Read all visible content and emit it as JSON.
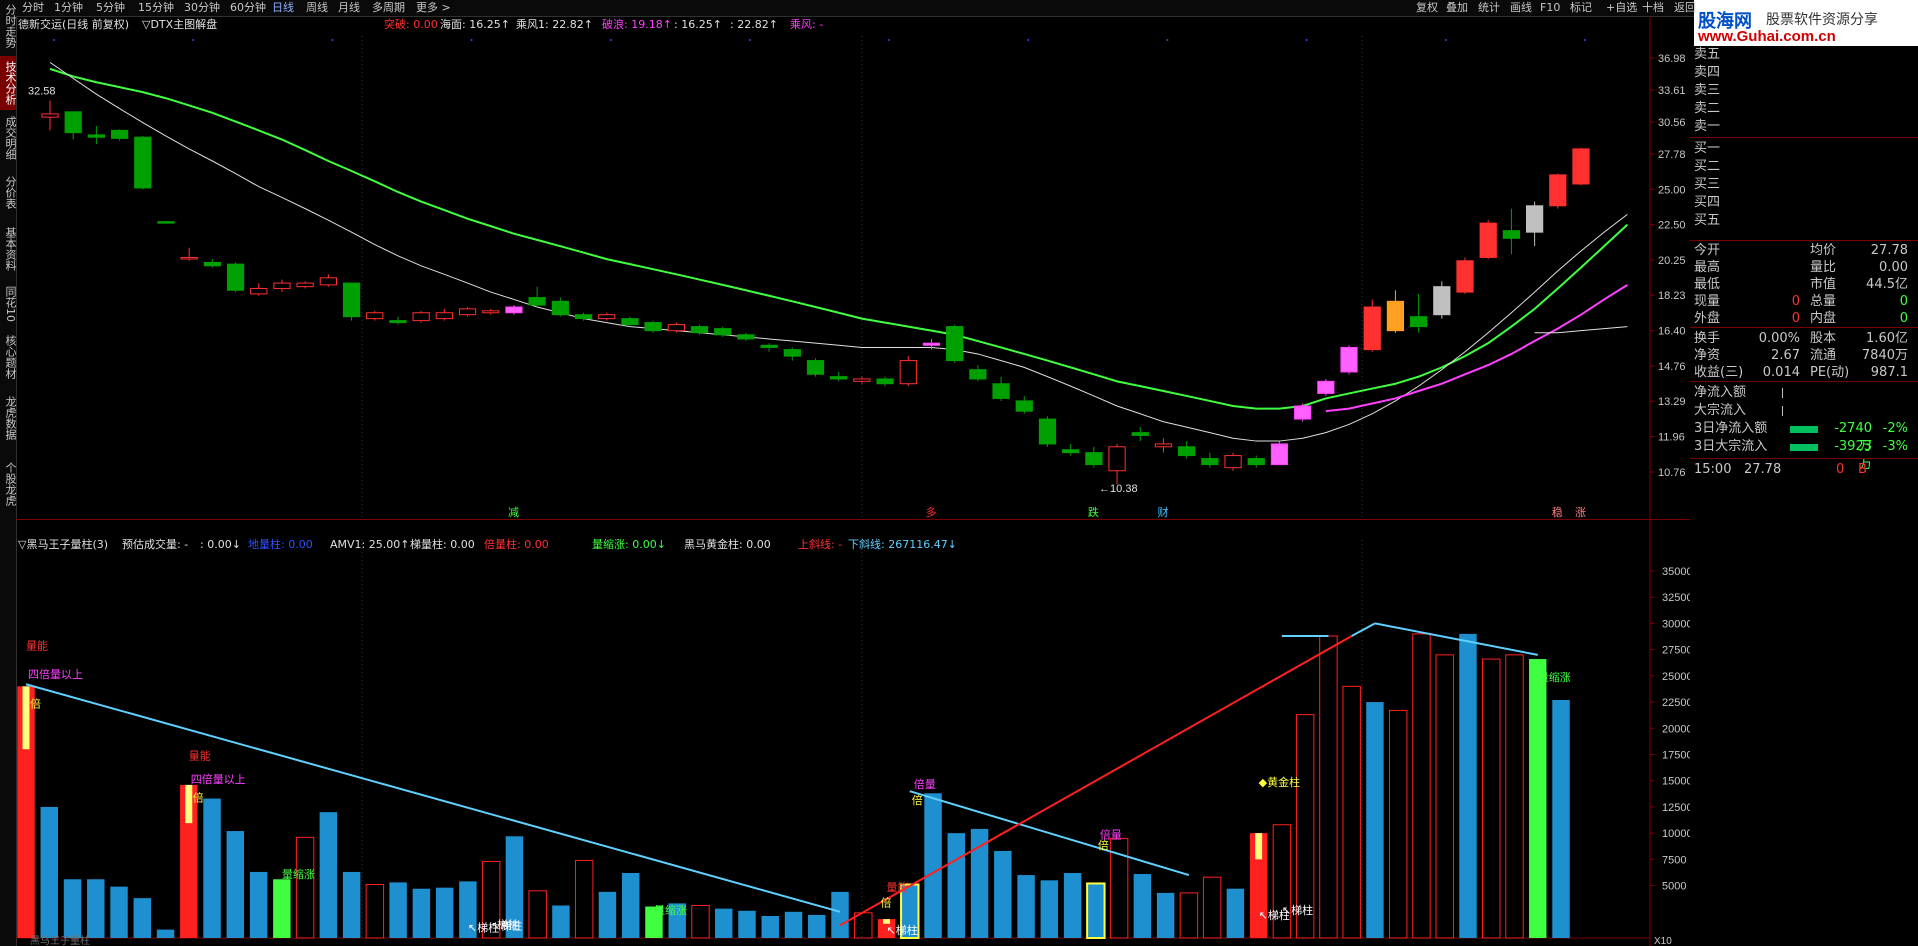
{
  "leftbar": {
    "items": [
      {
        "label": "分时走势",
        "active": false
      },
      {
        "label": "技术分析",
        "active": true
      },
      {
        "label": "成交明细",
        "active": false
      },
      {
        "label": "分价表",
        "active": false
      },
      {
        "label": "基本资料",
        "active": false
      },
      {
        "label": "同花10",
        "active": false
      },
      {
        "label": "核心题材",
        "active": false
      },
      {
        "label": "龙虎数据",
        "active": false
      },
      {
        "label": "个股龙虎",
        "active": false
      }
    ]
  },
  "topbar": {
    "periods": [
      {
        "label": "分时"
      },
      {
        "label": "1分钟"
      },
      {
        "label": "5分钟"
      },
      {
        "label": "15分钟"
      },
      {
        "label": "30分钟"
      },
      {
        "label": "60分钟"
      },
      {
        "label": "日线",
        "selected": true
      },
      {
        "label": "周线"
      },
      {
        "label": "月线"
      },
      {
        "label": "多周期"
      },
      {
        "label": "更多 >"
      }
    ],
    "tools": [
      {
        "label": "复权"
      },
      {
        "label": "叠加"
      },
      {
        "label": "统计"
      },
      {
        "label": "画线"
      },
      {
        "label": "F10"
      },
      {
        "label": "标记"
      },
      {
        "label": "+自选"
      },
      {
        "label": "十档"
      },
      {
        "label": "返回"
      }
    ]
  },
  "logo": {
    "brand": "股海网",
    "slogan": "股票软件资源分享",
    "url": "www.Guhai.com.cn"
  },
  "main_header": {
    "stock": "德新交运(日线 前复权)",
    "formula": "▽DTX主图解盘",
    "items": [
      {
        "text": "突破: 0.00",
        "color": "#ff3030"
      },
      {
        "text": "海面: 16.25↑",
        "color": "#e0e0e0"
      },
      {
        "text": "乘风1: 22.82↑",
        "color": "#e0e0e0"
      },
      {
        "text": "破浪: 19.18↑",
        "color": "#ff40ff"
      },
      {
        "text": ": 16.25↑",
        "color": "#e0e0e0"
      },
      {
        "text": ": 22.82↑",
        "color": "#e0e0e0"
      },
      {
        "text": "乘风: -",
        "color": "#ff40ff"
      }
    ]
  },
  "vol_header": {
    "formula": "▽黑马王子量柱(3)",
    "items": [
      {
        "text": "预估成交量: -",
        "color": "#e0e0e0"
      },
      {
        "text": ": 0.00↓",
        "color": "#e0e0e0"
      },
      {
        "text": "地量柱: 0.00",
        "color": "#3050ff"
      },
      {
        "text": "AMV1: 25.00↑",
        "color": "#e0e0e0"
      },
      {
        "text": "梯量柱: 0.00",
        "color": "#e0e0e0"
      },
      {
        "text": "倍量柱: 0.00",
        "color": "#ff3030"
      },
      {
        "text": "量缩涨: 0.00↓",
        "color": "#40ff40"
      },
      {
        "text": "黑马黄金柱: 0.00",
        "color": "#e0e0e0"
      },
      {
        "text": "上斜线: -",
        "color": "#ff3030"
      },
      {
        "text": "下斜线: 267116.47↓",
        "color": "#60d0ff"
      }
    ]
  },
  "price_axis": [
    "36.98",
    "33.61",
    "30.56",
    "27.78",
    "25.00",
    "22.50",
    "20.25",
    "18.23",
    "16.40",
    "14.76",
    "13.29",
    "11.96",
    "10.76"
  ],
  "vol_axis": [
    "35000",
    "32500",
    "30000",
    "27500",
    "25000",
    "22500",
    "20000",
    "17500",
    "15000",
    "12500",
    "10000",
    "7500",
    "5000"
  ],
  "vol_axis_unit": "X10",
  "price_labels": {
    "high": "32.58",
    "low": "←10.38"
  },
  "main_annotations": [
    {
      "text": "减",
      "color": "#40ff40"
    },
    {
      "text": "多",
      "color": "#ff3030"
    },
    {
      "text": "跌",
      "color": "#40ff40"
    },
    {
      "text": "财",
      "color": "#40c0ff"
    },
    {
      "text": "稳",
      "color": "#ff8080"
    },
    {
      "text": "涨",
      "color": "#ff8080"
    }
  ],
  "vol_annotations": [
    {
      "text": "量能",
      "color": "#ff3030"
    },
    {
      "text": "四倍量以上",
      "color": "#ff40ff"
    },
    {
      "text": "量能",
      "color": "#ff3030"
    },
    {
      "text": "四倍量以上",
      "color": "#ff40ff"
    },
    {
      "text": "量缩涨",
      "color": "#40ff40"
    },
    {
      "text": "量缩涨",
      "color": "#40ff40"
    },
    {
      "text": "量能",
      "color": "#ff3030"
    },
    {
      "text": "倍量",
      "color": "#ff40ff"
    },
    {
      "text": "倍量",
      "color": "#ff40ff"
    },
    {
      "text": "◆黄金柱",
      "color": "#ffff40"
    },
    {
      "text": "量缩涨",
      "color": "#40ff40"
    },
    {
      "text": "↖梯柱",
      "color": "#ffffff"
    },
    {
      "text": "↖梯柱",
      "color": "#ffffff"
    },
    {
      "text": "↖梯柱",
      "color": "#ffffff"
    },
    {
      "text": "↖梯柱",
      "color": "#ffffff"
    },
    {
      "text": "↖梯柱",
      "color": "#ffffff"
    },
    {
      "text": "梯柱",
      "color": "#ffffff"
    },
    {
      "text": "倍",
      "color": "#ffff40"
    },
    {
      "text": "倍",
      "color": "#ffff40"
    },
    {
      "text": "倍",
      "color": "#ffff40"
    },
    {
      "text": "倍",
      "color": "#ffff40"
    },
    {
      "text": "倍",
      "color": "#ffff40"
    }
  ],
  "order_book": {
    "sell": [
      "卖五",
      "卖四",
      "卖三",
      "卖二",
      "卖一"
    ],
    "buy": [
      "买一",
      "买二",
      "买三",
      "买四",
      "买五"
    ]
  },
  "quote": [
    {
      "l": "今开",
      "r_label": "均价",
      "r_val": "27.78"
    },
    {
      "l": "最高",
      "r_label": "量比",
      "r_val": "0.00"
    },
    {
      "l": "最低",
      "r_label": "市值",
      "r_val": "44.5亿"
    },
    {
      "l": "现量",
      "l_val": "0",
      "r_label": "总量",
      "r_val": "0"
    },
    {
      "l": "外盘",
      "l_val": "0",
      "r_label": "内盘",
      "r_val": "0"
    }
  ],
  "fundamentals": [
    {
      "l": "换手",
      "l_val": "0.00%",
      "r_label": "股本",
      "r_val": "1.60亿"
    },
    {
      "l": "净资",
      "l_val": "2.67",
      "r_label": "流通",
      "r_val": "7840万"
    },
    {
      "l": "收益(三)",
      "l_val": "0.014",
      "r_label": "PE(动)",
      "r_val": "987.1"
    }
  ],
  "flows": [
    {
      "l": "净流入额",
      "val": ""
    },
    {
      "l": "大宗流入",
      "val": ""
    },
    {
      "l": "3日净流入额",
      "val": "-2740万",
      "pct": "-2%"
    },
    {
      "l": "3日大宗流入",
      "val": "-3923万",
      "pct": "-3%"
    }
  ],
  "tick": {
    "time": "15:00",
    "price": "27.78",
    "vol": "0",
    "side": "B"
  },
  "bottom_status": "黑马王子量柱",
  "colors": {
    "up": "#ff3030",
    "down": "#00a000",
    "ma_green": "#40ff40",
    "ma_white": "#e0e0e0",
    "ma_magenta": "#ff40ff",
    "vol_blue": "#1e90d0",
    "downline": "#60d0ff",
    "upline": "#ff2020"
  },
  "candles": [
    {
      "o": 31.0,
      "h": 32.58,
      "l": 29.8,
      "c": 31.3
    },
    {
      "o": 31.5,
      "h": 31.5,
      "l": 29.0,
      "c": 29.6
    },
    {
      "o": 29.4,
      "h": 30.2,
      "l": 28.6,
      "c": 29.2
    },
    {
      "o": 29.8,
      "h": 29.9,
      "l": 28.9,
      "c": 29.1
    },
    {
      "o": 29.2,
      "h": 29.3,
      "l": 25.0,
      "c": 25.1
    },
    {
      "o": 22.7,
      "h": 22.7,
      "l": 22.6,
      "c": 22.6
    },
    {
      "o": 20.4,
      "h": 21.0,
      "l": 20.2,
      "c": 20.4
    },
    {
      "o": 20.1,
      "h": 20.3,
      "l": 19.8,
      "c": 19.9
    },
    {
      "o": 20.0,
      "h": 20.1,
      "l": 18.4,
      "c": 18.5
    },
    {
      "o": 18.3,
      "h": 18.9,
      "l": 18.2,
      "c": 18.6
    },
    {
      "o": 18.6,
      "h": 19.1,
      "l": 18.4,
      "c": 18.9
    },
    {
      "o": 18.7,
      "h": 19.0,
      "l": 18.6,
      "c": 18.9
    },
    {
      "o": 18.8,
      "h": 19.4,
      "l": 18.7,
      "c": 19.2
    },
    {
      "o": 18.9,
      "h": 18.9,
      "l": 16.9,
      "c": 17.1
    },
    {
      "o": 17.0,
      "h": 17.4,
      "l": 16.9,
      "c": 17.3
    },
    {
      "o": 16.9,
      "h": 17.1,
      "l": 16.7,
      "c": 16.8
    },
    {
      "o": 16.9,
      "h": 17.4,
      "l": 16.8,
      "c": 17.3
    },
    {
      "o": 17.0,
      "h": 17.5,
      "l": 16.9,
      "c": 17.3
    },
    {
      "o": 17.2,
      "h": 17.6,
      "l": 17.1,
      "c": 17.5
    },
    {
      "o": 17.3,
      "h": 17.5,
      "l": 17.2,
      "c": 17.4
    },
    {
      "o": 17.3,
      "h": 17.7,
      "l": 17.2,
      "c": 17.6
    },
    {
      "o": 18.1,
      "h": 18.7,
      "l": 17.6,
      "c": 17.7
    },
    {
      "o": 17.9,
      "h": 18.1,
      "l": 17.1,
      "c": 17.2
    },
    {
      "o": 17.2,
      "h": 17.3,
      "l": 16.9,
      "c": 17.0
    },
    {
      "o": 17.0,
      "h": 17.3,
      "l": 16.9,
      "c": 17.2
    },
    {
      "o": 17.0,
      "h": 17.1,
      "l": 16.6,
      "c": 16.7
    },
    {
      "o": 16.8,
      "h": 16.9,
      "l": 16.3,
      "c": 16.4
    },
    {
      "o": 16.4,
      "h": 16.8,
      "l": 16.3,
      "c": 16.7
    },
    {
      "o": 16.6,
      "h": 16.7,
      "l": 16.2,
      "c": 16.3
    },
    {
      "o": 16.5,
      "h": 16.6,
      "l": 16.1,
      "c": 16.2
    },
    {
      "o": 16.2,
      "h": 16.3,
      "l": 15.9,
      "c": 16.0
    },
    {
      "o": 15.7,
      "h": 15.8,
      "l": 15.4,
      "c": 15.6
    },
    {
      "o": 15.5,
      "h": 15.6,
      "l": 15.0,
      "c": 15.2
    },
    {
      "o": 15.0,
      "h": 15.1,
      "l": 14.3,
      "c": 14.4
    },
    {
      "o": 14.3,
      "h": 14.5,
      "l": 14.1,
      "c": 14.2
    },
    {
      "o": 14.1,
      "h": 14.3,
      "l": 14.0,
      "c": 14.2
    },
    {
      "o": 14.2,
      "h": 14.3,
      "l": 13.9,
      "c": 14.0
    },
    {
      "o": 14.0,
      "h": 15.2,
      "l": 13.9,
      "c": 15.0
    },
    {
      "o": 15.7,
      "h": 16.0,
      "l": 15.5,
      "c": 15.8
    },
    {
      "o": 16.6,
      "h": 16.7,
      "l": 14.9,
      "c": 15.0
    },
    {
      "o": 14.6,
      "h": 14.8,
      "l": 14.1,
      "c": 14.2
    },
    {
      "o": 14.0,
      "h": 14.3,
      "l": 13.3,
      "c": 13.4
    },
    {
      "o": 13.3,
      "h": 13.5,
      "l": 12.8,
      "c": 12.9
    },
    {
      "o": 12.6,
      "h": 12.7,
      "l": 11.6,
      "c": 11.7
    },
    {
      "o": 11.5,
      "h": 11.7,
      "l": 11.3,
      "c": 11.4
    },
    {
      "o": 11.4,
      "h": 11.6,
      "l": 10.9,
      "c": 11.0
    },
    {
      "o": 10.8,
      "h": 11.7,
      "l": 10.38,
      "c": 11.6
    },
    {
      "o": 12.1,
      "h": 12.3,
      "l": 11.8,
      "c": 12.0
    },
    {
      "o": 11.6,
      "h": 11.9,
      "l": 11.4,
      "c": 11.7
    },
    {
      "o": 11.6,
      "h": 11.8,
      "l": 11.2,
      "c": 11.3
    },
    {
      "o": 11.2,
      "h": 11.4,
      "l": 10.9,
      "c": 11.0
    },
    {
      "o": 10.9,
      "h": 11.4,
      "l": 10.8,
      "c": 11.3
    },
    {
      "o": 11.2,
      "h": 11.3,
      "l": 10.9,
      "c": 11.0
    },
    {
      "o": 11.0,
      "h": 11.8,
      "l": 11.0,
      "c": 11.7
    },
    {
      "o": 12.6,
      "h": 13.2,
      "l": 12.5,
      "c": 13.1
    },
    {
      "o": 13.6,
      "h": 14.2,
      "l": 13.5,
      "c": 14.1
    },
    {
      "o": 14.5,
      "h": 15.7,
      "l": 14.4,
      "c": 15.6
    },
    {
      "o": 15.5,
      "h": 18.0,
      "l": 15.4,
      "c": 17.6
    },
    {
      "o": 16.4,
      "h": 18.5,
      "l": 16.3,
      "c": 17.9
    },
    {
      "o": 17.1,
      "h": 18.3,
      "l": 16.3,
      "c": 16.6
    },
    {
      "o": 17.2,
      "h": 19.0,
      "l": 17.0,
      "c": 18.7
    },
    {
      "o": 18.4,
      "h": 20.4,
      "l": 18.3,
      "c": 20.2
    },
    {
      "o": 20.4,
      "h": 22.8,
      "l": 20.3,
      "c": 22.6
    },
    {
      "o": 22.1,
      "h": 23.6,
      "l": 20.6,
      "c": 21.6
    },
    {
      "o": 22.0,
      "h": 24.1,
      "l": 21.1,
      "c": 23.8
    },
    {
      "o": 23.8,
      "h": 26.2,
      "l": 23.6,
      "c": 26.1
    },
    {
      "o": 25.4,
      "h": 28.3,
      "l": 25.3,
      "c": 28.2
    }
  ],
  "candle_styles": {
    "20": "magenta",
    "38": "magenta",
    "53": "magenta",
    "54": "magenta",
    "55": "magenta",
    "56": "magenta",
    "58": "orange",
    "60": "gray",
    "64": "gray"
  },
  "ma_green": [
    35.8,
    35.0,
    34.4,
    33.9,
    33.4,
    32.8,
    32.1,
    31.4,
    30.6,
    29.8,
    29.0,
    28.1,
    27.2,
    26.4,
    25.6,
    24.8,
    24.1,
    23.5,
    22.9,
    22.4,
    21.9,
    21.5,
    21.1,
    20.7,
    20.3,
    20.0,
    19.7,
    19.4,
    19.1,
    18.8,
    18.5,
    18.2,
    17.9,
    17.6,
    17.3,
    17.0,
    16.8,
    16.6,
    16.4,
    16.2,
    15.9,
    15.6,
    15.3,
    15.0,
    14.7,
    14.4,
    14.1,
    13.9,
    13.7,
    13.5,
    13.3,
    13.1,
    13.0,
    13.0,
    13.1,
    13.4,
    13.6,
    13.8,
    14.0,
    14.3,
    14.7,
    15.2,
    15.8,
    16.6,
    17.5,
    18.6,
    19.8,
    21.1,
    22.5
  ],
  "ma_white": [
    36.5,
    34.8,
    33.2,
    31.8,
    30.5,
    29.3,
    28.2,
    27.2,
    26.2,
    25.2,
    24.4,
    23.6,
    22.8,
    22.0,
    21.2,
    20.5,
    19.9,
    19.4,
    18.9,
    18.4,
    18.0,
    17.6,
    17.3,
    17.0,
    16.8,
    16.6,
    16.5,
    16.4,
    16.3,
    16.2,
    16.1,
    16.0,
    15.9,
    15.8,
    15.7,
    15.6,
    15.6,
    15.6,
    15.6,
    15.5,
    15.3,
    15.0,
    14.7,
    14.3,
    13.9,
    13.5,
    13.1,
    12.8,
    12.5,
    12.3,
    12.1,
    11.9,
    11.8,
    11.8,
    11.9,
    12.1,
    12.4,
    12.8,
    13.3,
    13.9,
    14.6,
    15.4,
    16.3,
    17.3,
    18.4,
    19.6,
    20.8,
    22.0,
    23.2
  ],
  "ma_magenta": {
    "start": 55,
    "values": [
      12.9,
      13.0,
      13.2,
      13.4,
      13.7,
      14.0,
      14.4,
      14.8,
      15.3,
      15.9,
      16.5,
      17.2,
      18.0,
      18.8
    ]
  },
  "ma_flat": {
    "start": 64,
    "values": [
      16.3,
      16.3,
      16.4,
      16.5,
      16.6
    ]
  },
  "volumes": [
    24000,
    12500,
    5600,
    5600,
    4900,
    3800,
    800,
    14600,
    13300,
    10200,
    6300,
    5600,
    9600,
    12000,
    6300,
    5100,
    5300,
    4700,
    4800,
    5400,
    7300,
    9700,
    4500,
    3100,
    7400,
    4400,
    6200,
    3000,
    3300,
    3100,
    2800,
    2600,
    2100,
    2500,
    2200,
    4400,
    2400,
    1800,
    5100,
    13800,
    10000,
    10400,
    8300,
    6000,
    5500,
    6200,
    5200,
    9500,
    6100,
    4300,
    4300,
    5800,
    4700,
    10000,
    10800,
    21300,
    28800,
    24000,
    22500,
    21700,
    29000,
    27000,
    29000,
    26600,
    27000,
    26600,
    22700
  ],
  "volume_styles": {
    "0": "red",
    "7": "red",
    "11": "green",
    "12": "hollow",
    "15": "hollow",
    "20": "hollow",
    "22": "hollow",
    "24": "hollow",
    "27": "green",
    "29": "hollow",
    "36": "hollow",
    "37": "red",
    "38": "yellow",
    "46": "yellow",
    "47": "hollow",
    "50": "hollow",
    "51": "hollow",
    "53": "red",
    "54": "hollow",
    "55": "hollow",
    "56": "hollow",
    "57": "hollow",
    "59": "hollow",
    "60": "hollow",
    "61": "hollow",
    "63": "hollow",
    "64": "hollow",
    "65": "green"
  }
}
